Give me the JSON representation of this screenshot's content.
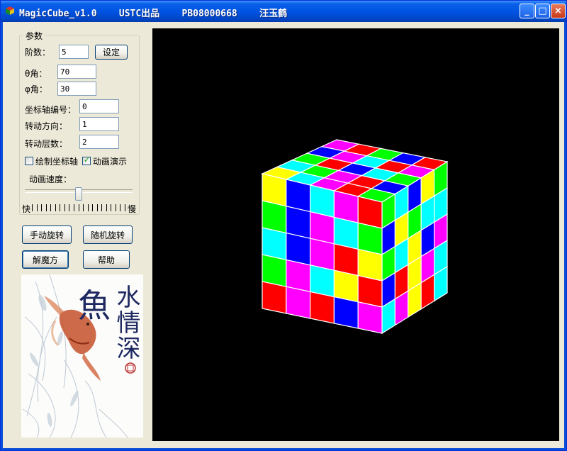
{
  "window": {
    "title": "MagicCube_v1.0    USTC出品    PB08000668    汪玉鹤",
    "min_glyph": "_",
    "max_glyph": "□",
    "close_glyph": "×"
  },
  "params": {
    "group_title": "参数",
    "order_label": "阶数：",
    "order_value": "5",
    "set_button": "设定",
    "theta_label": "θ角：",
    "theta_value": "70",
    "phi_label": "φ角：",
    "phi_value": "30",
    "axis_label": "坐标轴编号：",
    "axis_value": "0",
    "direction_label": "转动方向：",
    "direction_value": "1",
    "layer_label": "转动层数：",
    "layer_value": "2",
    "draw_axis_label": "绘制坐标轴",
    "draw_axis_checked": false,
    "animate_label": "动画演示",
    "animate_checked": true,
    "speed_label": "动画速度：",
    "speed_fast": "快",
    "speed_slow": "慢",
    "speed_value": 0.5
  },
  "buttons": {
    "manual_rotate": "手动旋转",
    "random_rotate": "随机旋转",
    "solve": "解魔方",
    "help": "帮助"
  },
  "painting": {
    "calligraphy": "水情深",
    "fish_char": "魚"
  },
  "colors": {
    "titlebar": "#0054e3",
    "canvas_bg": "#000000",
    "cube_red": "#ff0000",
    "cube_green": "#00ff00",
    "cube_blue": "#0000ff",
    "cube_cyan": "#00ffff",
    "cube_magenta": "#ff00ff",
    "cube_yellow": "#ffff00"
  }
}
